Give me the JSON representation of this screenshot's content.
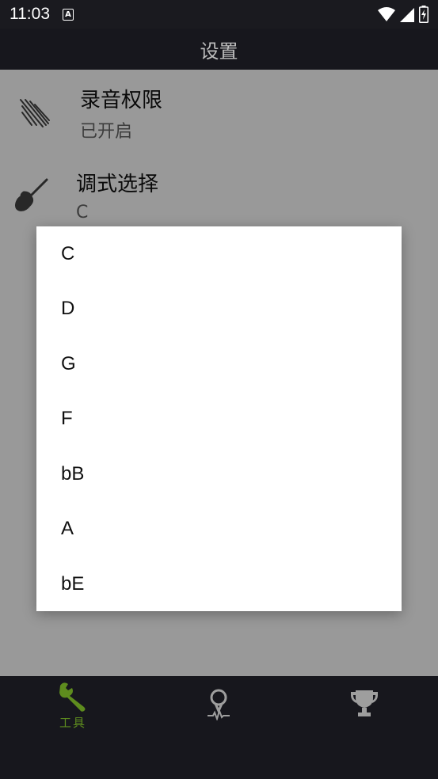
{
  "status_bar": {
    "time": "11:03",
    "a_icon": "A"
  },
  "app_bar": {
    "title": "设置"
  },
  "settings": {
    "record_permission": {
      "title": "录音权限",
      "value": "已开启",
      "icon": "microphone-lines-icon"
    },
    "mode_select": {
      "title": "调式选择",
      "value": "C",
      "icon": "guitar-icon"
    }
  },
  "dialog": {
    "options": [
      "C",
      "D",
      "G",
      "F",
      "bB",
      "A",
      "bE"
    ]
  },
  "bottom_nav": {
    "tools_label": "工具",
    "active_color": "#5e8c1e",
    "inactive_color": "#9e9e9e"
  }
}
